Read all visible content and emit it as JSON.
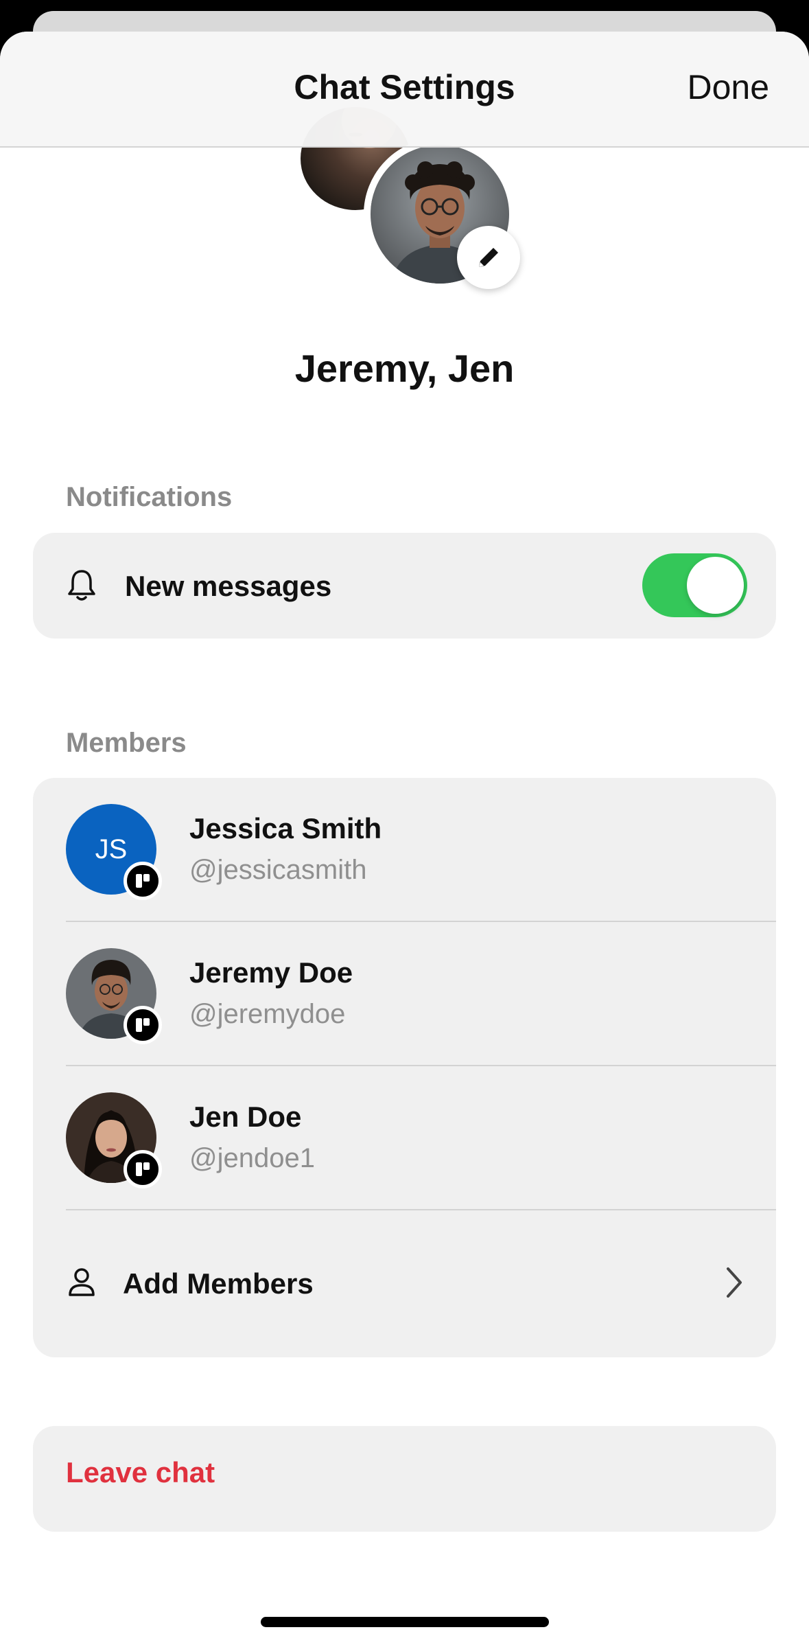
{
  "header": {
    "title": "Chat Settings",
    "done_label": "Done"
  },
  "group": {
    "name": "Jeremy, Jen"
  },
  "notifications": {
    "section_label": "Notifications",
    "new_messages_label": "New messages",
    "new_messages_enabled": true,
    "toggle_color": "#34c759"
  },
  "members": {
    "section_label": "Members",
    "list": [
      {
        "name": "Jessica Smith",
        "handle": "@jessicasmith",
        "initials": "JS",
        "avatar_color": "#0a63c0"
      },
      {
        "name": "Jeremy Doe",
        "handle": "@jeremydoe"
      },
      {
        "name": "Jen Doe",
        "handle": "@jendoe1"
      }
    ],
    "add_label": "Add Members"
  },
  "leave": {
    "label": "Leave chat",
    "color": "#e0313e"
  }
}
